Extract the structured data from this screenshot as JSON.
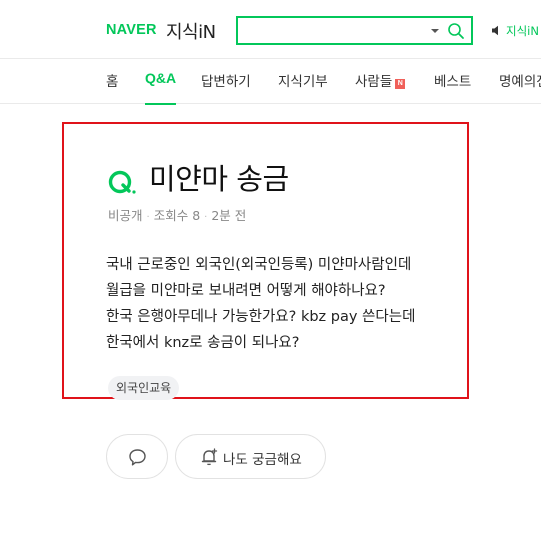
{
  "header": {
    "naver_logo": "NAVER",
    "kin_logo": "지식iN",
    "search_value": "",
    "kin_link": "지식iN"
  },
  "tabs": [
    {
      "label": "홈",
      "active": false
    },
    {
      "label": "Q&A",
      "active": true
    },
    {
      "label": "답변하기",
      "active": false
    },
    {
      "label": "지식기부",
      "active": false
    },
    {
      "label": "사람들",
      "active": false,
      "badge": "N"
    },
    {
      "label": "베스트",
      "active": false
    },
    {
      "label": "명예의전당",
      "active": false
    }
  ],
  "question": {
    "title": "미얀마 송금",
    "meta": {
      "author": "비공개",
      "views_label": "조회수",
      "views": "8",
      "time": "2분 전"
    },
    "body": [
      "국내 근로중인 외국인(외국인등록) 미얀마사람인데",
      "월급을 미얀마로 보내려면 어떻게 해야하나요?",
      "한국 은행아무데나 가능한가요? kbz pay 쓴다는데",
      "한국에서 knz로 송금이 되나요?"
    ],
    "tag": "외국인교육"
  },
  "actions": {
    "curious_label": "나도 궁금해요"
  },
  "colors": {
    "brand": "#03c75a",
    "highlight_border": "#e0131a",
    "new_badge": "#f0605a"
  }
}
